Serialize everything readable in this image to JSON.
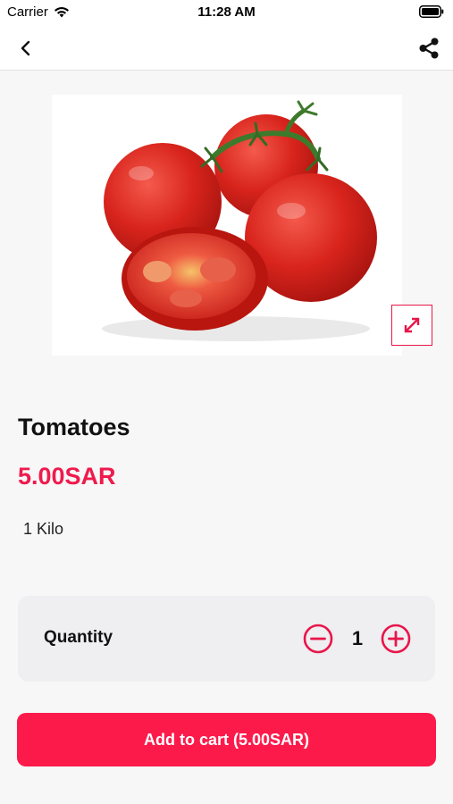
{
  "status_bar": {
    "carrier": "Carrier",
    "time": "11:28 AM"
  },
  "nav": {
    "back_icon": "chevron-left-icon",
    "share_icon": "share-icon"
  },
  "product": {
    "image_alt": "tomatoes-image",
    "name": "Tomatoes",
    "price": "5.00SAR",
    "unit": "1 Kilo"
  },
  "quantity": {
    "label": "Quantity",
    "value": "1"
  },
  "cart": {
    "button_label": "Add to cart (5.00SAR)"
  },
  "colors": {
    "accent": "#ee1b4d",
    "button": "#fc1a4b",
    "card": "#efeef1",
    "background": "#f7f7f7"
  }
}
